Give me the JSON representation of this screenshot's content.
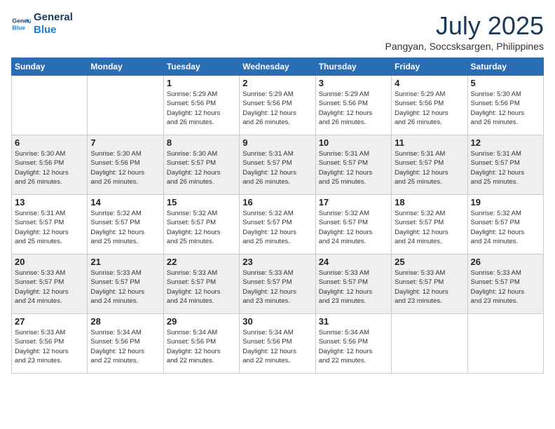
{
  "header": {
    "logo_line1": "General",
    "logo_line2": "Blue",
    "month_year": "July 2025",
    "location": "Pangyan, Soccsksargen, Philippines"
  },
  "weekdays": [
    "Sunday",
    "Monday",
    "Tuesday",
    "Wednesday",
    "Thursday",
    "Friday",
    "Saturday"
  ],
  "weeks": [
    [
      {
        "day": "",
        "info": ""
      },
      {
        "day": "",
        "info": ""
      },
      {
        "day": "1",
        "info": "Sunrise: 5:29 AM\nSunset: 5:56 PM\nDaylight: 12 hours\nand 26 minutes."
      },
      {
        "day": "2",
        "info": "Sunrise: 5:29 AM\nSunset: 5:56 PM\nDaylight: 12 hours\nand 26 minutes."
      },
      {
        "day": "3",
        "info": "Sunrise: 5:29 AM\nSunset: 5:56 PM\nDaylight: 12 hours\nand 26 minutes."
      },
      {
        "day": "4",
        "info": "Sunrise: 5:29 AM\nSunset: 5:56 PM\nDaylight: 12 hours\nand 26 minutes."
      },
      {
        "day": "5",
        "info": "Sunrise: 5:30 AM\nSunset: 5:56 PM\nDaylight: 12 hours\nand 26 minutes."
      }
    ],
    [
      {
        "day": "6",
        "info": "Sunrise: 5:30 AM\nSunset: 5:56 PM\nDaylight: 12 hours\nand 26 minutes."
      },
      {
        "day": "7",
        "info": "Sunrise: 5:30 AM\nSunset: 5:56 PM\nDaylight: 12 hours\nand 26 minutes."
      },
      {
        "day": "8",
        "info": "Sunrise: 5:30 AM\nSunset: 5:57 PM\nDaylight: 12 hours\nand 26 minutes."
      },
      {
        "day": "9",
        "info": "Sunrise: 5:31 AM\nSunset: 5:57 PM\nDaylight: 12 hours\nand 26 minutes."
      },
      {
        "day": "10",
        "info": "Sunrise: 5:31 AM\nSunset: 5:57 PM\nDaylight: 12 hours\nand 25 minutes."
      },
      {
        "day": "11",
        "info": "Sunrise: 5:31 AM\nSunset: 5:57 PM\nDaylight: 12 hours\nand 25 minutes."
      },
      {
        "day": "12",
        "info": "Sunrise: 5:31 AM\nSunset: 5:57 PM\nDaylight: 12 hours\nand 25 minutes."
      }
    ],
    [
      {
        "day": "13",
        "info": "Sunrise: 5:31 AM\nSunset: 5:57 PM\nDaylight: 12 hours\nand 25 minutes."
      },
      {
        "day": "14",
        "info": "Sunrise: 5:32 AM\nSunset: 5:57 PM\nDaylight: 12 hours\nand 25 minutes."
      },
      {
        "day": "15",
        "info": "Sunrise: 5:32 AM\nSunset: 5:57 PM\nDaylight: 12 hours\nand 25 minutes."
      },
      {
        "day": "16",
        "info": "Sunrise: 5:32 AM\nSunset: 5:57 PM\nDaylight: 12 hours\nand 25 minutes."
      },
      {
        "day": "17",
        "info": "Sunrise: 5:32 AM\nSunset: 5:57 PM\nDaylight: 12 hours\nand 24 minutes."
      },
      {
        "day": "18",
        "info": "Sunrise: 5:32 AM\nSunset: 5:57 PM\nDaylight: 12 hours\nand 24 minutes."
      },
      {
        "day": "19",
        "info": "Sunrise: 5:32 AM\nSunset: 5:57 PM\nDaylight: 12 hours\nand 24 minutes."
      }
    ],
    [
      {
        "day": "20",
        "info": "Sunrise: 5:33 AM\nSunset: 5:57 PM\nDaylight: 12 hours\nand 24 minutes."
      },
      {
        "day": "21",
        "info": "Sunrise: 5:33 AM\nSunset: 5:57 PM\nDaylight: 12 hours\nand 24 minutes."
      },
      {
        "day": "22",
        "info": "Sunrise: 5:33 AM\nSunset: 5:57 PM\nDaylight: 12 hours\nand 24 minutes."
      },
      {
        "day": "23",
        "info": "Sunrise: 5:33 AM\nSunset: 5:57 PM\nDaylight: 12 hours\nand 23 minutes."
      },
      {
        "day": "24",
        "info": "Sunrise: 5:33 AM\nSunset: 5:57 PM\nDaylight: 12 hours\nand 23 minutes."
      },
      {
        "day": "25",
        "info": "Sunrise: 5:33 AM\nSunset: 5:57 PM\nDaylight: 12 hours\nand 23 minutes."
      },
      {
        "day": "26",
        "info": "Sunrise: 5:33 AM\nSunset: 5:57 PM\nDaylight: 12 hours\nand 23 minutes."
      }
    ],
    [
      {
        "day": "27",
        "info": "Sunrise: 5:33 AM\nSunset: 5:56 PM\nDaylight: 12 hours\nand 23 minutes."
      },
      {
        "day": "28",
        "info": "Sunrise: 5:34 AM\nSunset: 5:56 PM\nDaylight: 12 hours\nand 22 minutes."
      },
      {
        "day": "29",
        "info": "Sunrise: 5:34 AM\nSunset: 5:56 PM\nDaylight: 12 hours\nand 22 minutes."
      },
      {
        "day": "30",
        "info": "Sunrise: 5:34 AM\nSunset: 5:56 PM\nDaylight: 12 hours\nand 22 minutes."
      },
      {
        "day": "31",
        "info": "Sunrise: 5:34 AM\nSunset: 5:56 PM\nDaylight: 12 hours\nand 22 minutes."
      },
      {
        "day": "",
        "info": ""
      },
      {
        "day": "",
        "info": ""
      }
    ]
  ]
}
